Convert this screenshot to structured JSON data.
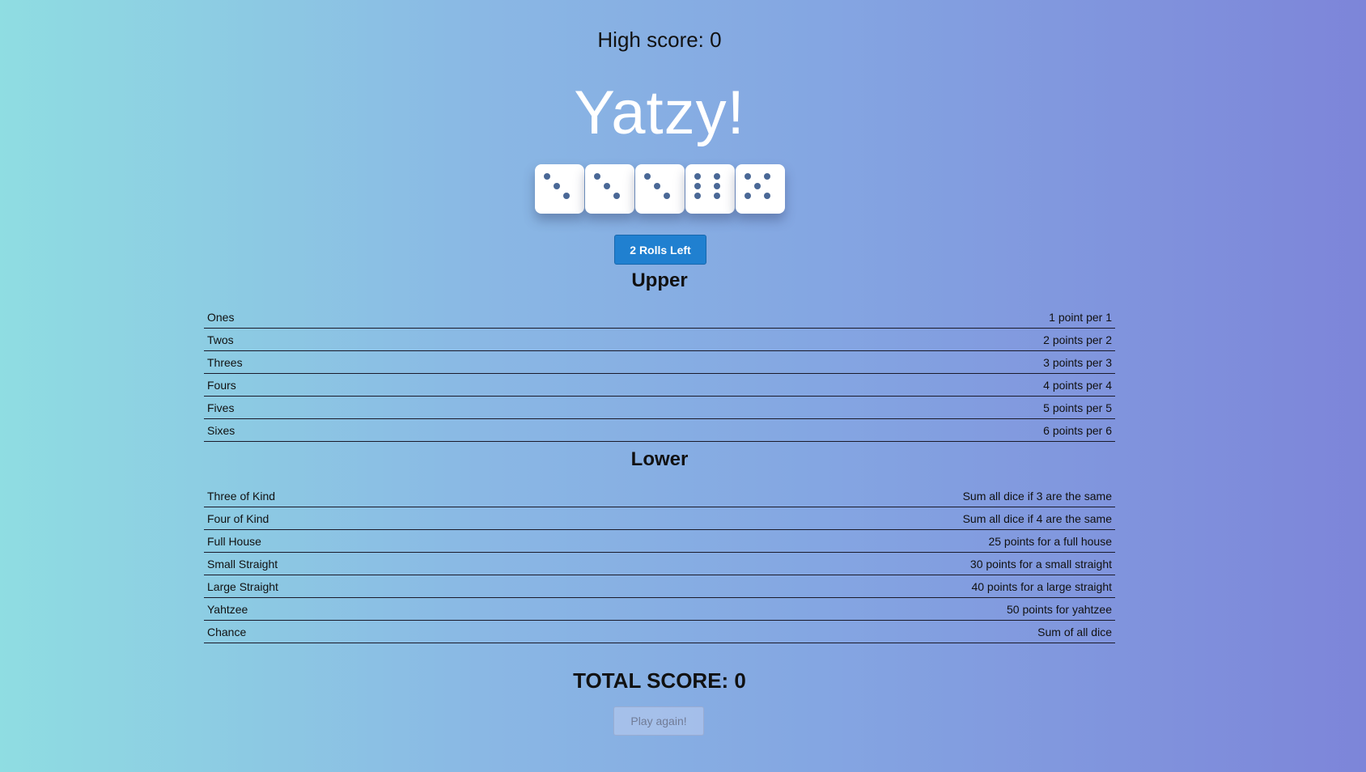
{
  "high_score": "High score: 0",
  "title": "Yatzy!",
  "dice": [
    {
      "value": 3
    },
    {
      "value": 3
    },
    {
      "value": 3
    },
    {
      "value": 6
    },
    {
      "value": 5
    }
  ],
  "roll_button": "2 Rolls Left",
  "upper": {
    "title": "Upper",
    "rows": [
      {
        "name": "Ones",
        "description": "1 point per 1"
      },
      {
        "name": "Twos",
        "description": "2 points per 2"
      },
      {
        "name": "Threes",
        "description": "3 points per 3"
      },
      {
        "name": "Fours",
        "description": "4 points per 4"
      },
      {
        "name": "Fives",
        "description": "5 points per 5"
      },
      {
        "name": "Sixes",
        "description": "6 points per 6"
      }
    ]
  },
  "lower": {
    "title": "Lower",
    "rows": [
      {
        "name": "Three of Kind",
        "description": "Sum all dice if 3 are the same"
      },
      {
        "name": "Four of Kind",
        "description": "Sum all dice if 4 are the same"
      },
      {
        "name": "Full House",
        "description": "25 points for a full house"
      },
      {
        "name": "Small Straight",
        "description": "30 points for a small straight"
      },
      {
        "name": "Large Straight",
        "description": "40 points for a large straight"
      },
      {
        "name": "Yahtzee",
        "description": "50 points for yahtzee"
      },
      {
        "name": "Chance",
        "description": "Sum of all dice"
      }
    ]
  },
  "total_score": "TOTAL SCORE: 0",
  "play_again": "Play again!",
  "colors": {
    "pip": "#4a6896",
    "roll_button": "#2080d0",
    "title": "#ffffff"
  }
}
